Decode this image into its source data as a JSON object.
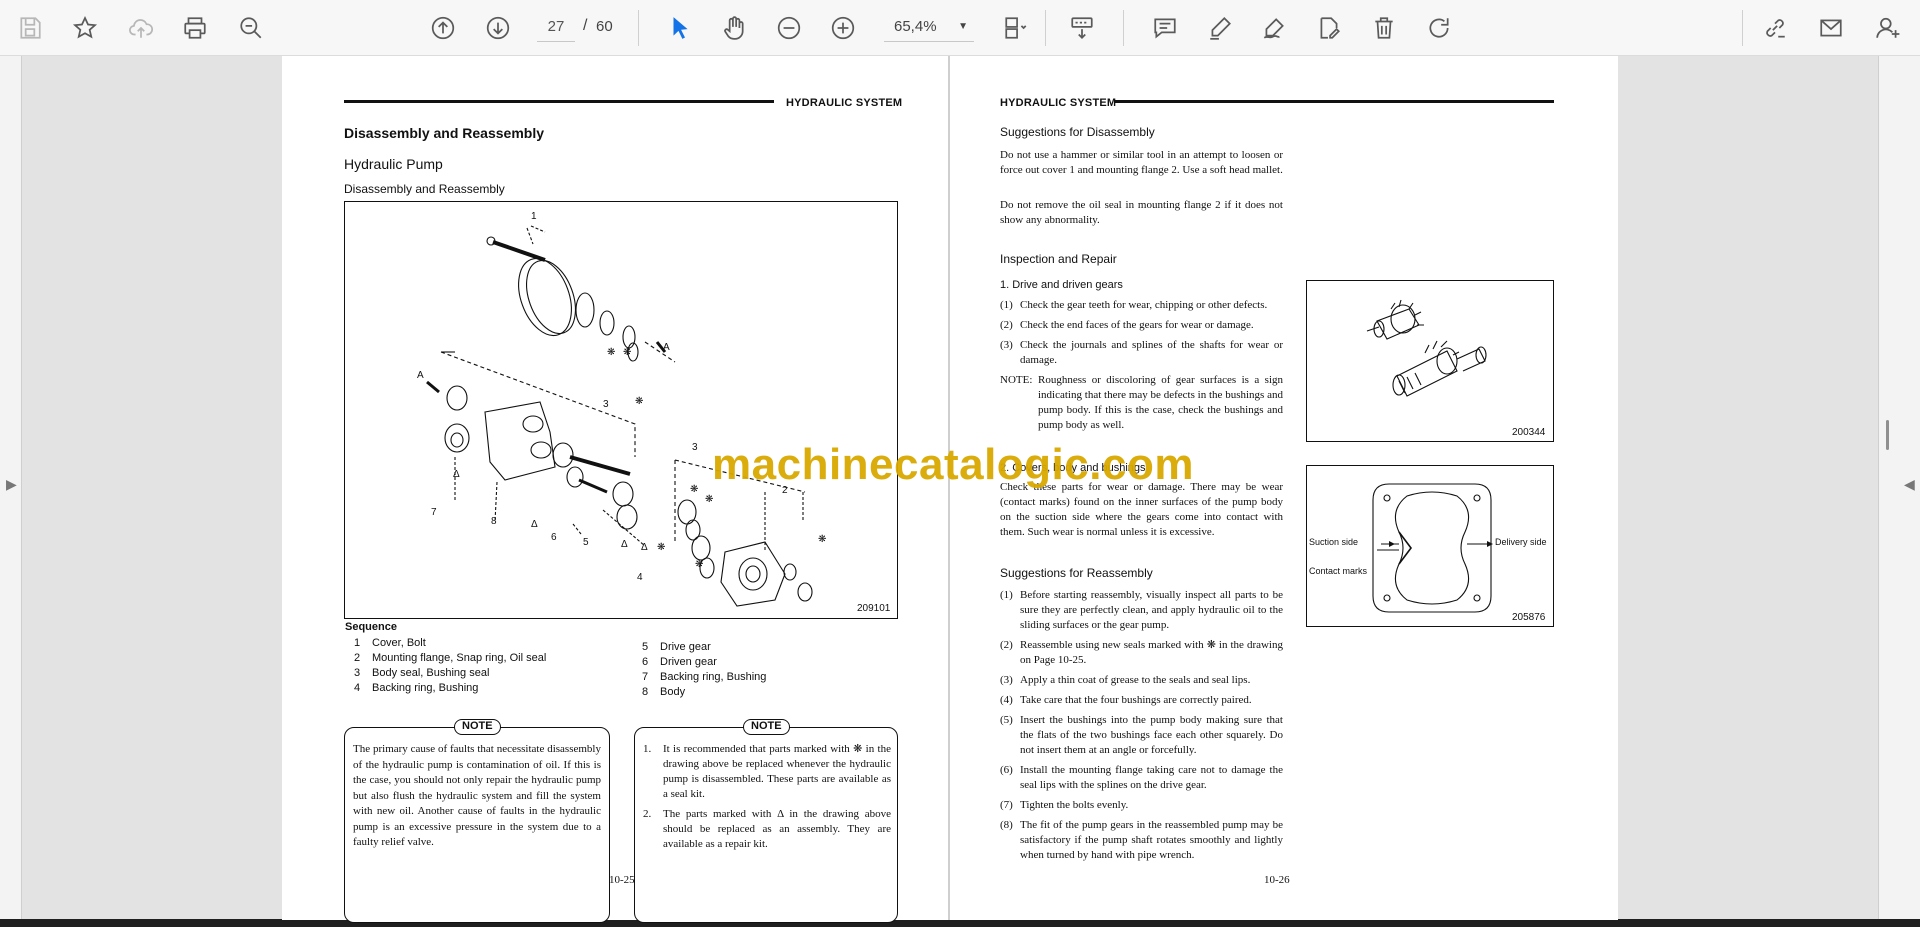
{
  "toolbar": {
    "page_current": "27",
    "page_total": "60",
    "zoom": "65,4%"
  },
  "left_page": {
    "header": "HYDRAULIC SYSTEM",
    "title": "Disassembly and Reassembly",
    "subtitle": "Hydraulic Pump",
    "section": "Disassembly and Reassembly",
    "figure_id": "209101",
    "figure_callouts": [
      "1",
      "3",
      "A",
      "A",
      "3",
      "7",
      "8",
      "6",
      "5",
      "4",
      "2"
    ],
    "sequence_title": "Sequence",
    "sequence_left": [
      {
        "n": "1",
        "t": "Cover, Bolt"
      },
      {
        "n": "2",
        "t": "Mounting flange, Snap ring, Oil seal"
      },
      {
        "n": "3",
        "t": "Body seal, Bushing seal"
      },
      {
        "n": "4",
        "t": "Backing ring, Bushing"
      }
    ],
    "sequence_right": [
      {
        "n": "5",
        "t": "Drive gear"
      },
      {
        "n": "6",
        "t": "Driven gear"
      },
      {
        "n": "7",
        "t": "Backing ring, Bushing"
      },
      {
        "n": "8",
        "t": "Body"
      }
    ],
    "note1_tag": "NOTE",
    "note1_text": "The primary cause of faults that necessitate disassembly of the hydraulic pump is contamination of oil. If this is the case, you should not only repair the hydraulic pump but also flush the hydraulic system and fill the system with new oil. Another cause of faults in the hydraulic pump is an excessive pressure in the system due to a faulty relief valve.",
    "note2_tag": "NOTE",
    "note2_items": [
      {
        "n": "1.",
        "t": "It is recommended that parts marked with ❋ in the drawing above be replaced whenever the hydraulic pump is disassembled. These parts are available as a seal kit."
      },
      {
        "n": "2.",
        "t": "The parts marked with Δ in the drawing above should be replaced as an assembly. They are available as a repair kit."
      }
    ],
    "page_number": "10-25"
  },
  "right_page": {
    "header": "HYDRAULIC SYSTEM",
    "sugg_disassembly_title": "Suggestions for Disassembly",
    "sugg_disassembly_p1": "Do not use a hammer or similar tool in an attempt to loosen or force out cover 1 and mounting flange 2. Use a soft head mallet.",
    "sugg_disassembly_p2": "Do not remove the oil seal in mounting flange 2 if it does not show any abnormality.",
    "inspection_title": "Inspection and Repair",
    "item1_title": "1.   Drive and driven gears",
    "item1_list": [
      {
        "n": "(1)",
        "t": "Check the gear teeth for wear, chipping or other defects."
      },
      {
        "n": "(2)",
        "t": "Check the end faces of the gears for wear or damage."
      },
      {
        "n": "(3)",
        "t": "Check the journals and splines of the shafts for wear or damage."
      },
      {
        "n": "NOTE:",
        "t": "Roughness or discoloring of gear surfaces is a sign indicating that there may be defects in the bushings and pump body. If this is the case, check the bushings and pump body as well."
      }
    ],
    "item2_title": "2.   Covers, body and bushings",
    "item2_text": "Check these parts for wear or damage. There may be wear (contact marks) found on the inner surfaces of the pump body on the suction side where the gears come into contact with them. Such wear is normal unless it is excessive.",
    "figure1_id": "200344",
    "figure2_id": "205876",
    "figure2_suction": "Suction side",
    "figure2_delivery": "Delivery side",
    "figure2_contact": "Contact marks",
    "sugg_reassembly_title": "Suggestions for Reassembly",
    "reassembly_list": [
      {
        "n": "(1)",
        "t": "Before starting reassembly, visually inspect all parts to be sure they are perfectly clean, and apply hydraulic oil to the sliding surfaces or the gear pump."
      },
      {
        "n": "(2)",
        "t": "Reassemble using new seals marked with ❋ in the drawing on Page 10-25."
      },
      {
        "n": "(3)",
        "t": "Apply a thin coat of grease to the seals and seal lips."
      },
      {
        "n": "(4)",
        "t": "Take care that the four bushings are correctly paired."
      },
      {
        "n": "(5)",
        "t": "Insert the bushings into the pump body making sure that the flats of the two bushings face each other squarely. Do not insert them at an angle or forcefully."
      },
      {
        "n": "(6)",
        "t": "Install the mounting flange taking care not to damage the seal lips with the splines on the drive gear."
      },
      {
        "n": "(7)",
        "t": "Tighten the bolts evenly."
      },
      {
        "n": "(8)",
        "t": "The fit of the pump gears in the reassembled pump may be satisfactory if the pump shaft rotates smoothly and lightly when turned by hand with pipe wrench."
      }
    ],
    "page_number": "10-26"
  },
  "watermark": "machinecatalogic.com"
}
